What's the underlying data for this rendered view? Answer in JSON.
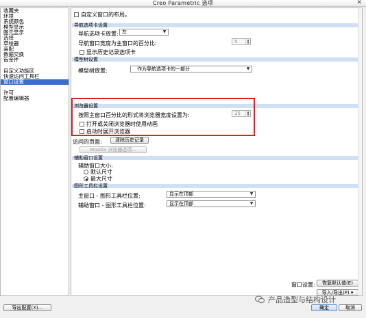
{
  "window": {
    "title": "Creo Parametric 选项",
    "close_glyph": "✕"
  },
  "sidebar": {
    "items": [
      "收藏夹",
      "环境",
      "系统颜色",
      "模型显示",
      "图元显示",
      "选择",
      "草绘器",
      "装配",
      "数据交换",
      "钣金件"
    ],
    "items2": [
      "自定义功能区",
      "快速访问工具栏",
      "窗口设置"
    ],
    "items3": [
      "许可",
      "配置编辑器"
    ],
    "selected": "窗口设置"
  },
  "top_option": {
    "label": "自定义窗口的布局。"
  },
  "nav": {
    "header": "导航选项卡设置",
    "tab_placement_label": "导航选项卡放置:",
    "tab_placement_value": "左",
    "percent_label": "导航窗口宽度为主窗口的百分比:",
    "percent_value": "5",
    "history_label": "显示历史记录选项卡"
  },
  "tree": {
    "header": "模型树设置",
    "placement_label": "模型树放置:",
    "placement_value": "作为导航选项卡的一部分"
  },
  "browser": {
    "header": "浏览器设置",
    "width_label": "按照主窗口百分比的形式将浏览器宽度设置为:",
    "width_value": "25",
    "anim_label": "打开或关闭浏览器时使用动画",
    "expand_label": "启动时展开浏览器",
    "visited_label": "访问的页面:",
    "clear_button": "清除历史记录",
    "mozilla_button": "Mozilla 浏览器选项..."
  },
  "aux": {
    "header": "辅助窗口设置",
    "size_label": "辅助窗口大小:",
    "default_size": "默认尺寸",
    "max_size": "最大尺寸"
  },
  "graphics": {
    "header": "图形工具栏设置",
    "main_label": "主窗口 - 图形工具栏位置:",
    "main_value": "显示在顶部",
    "aux_label": "辅助窗口 - 图形工具栏位置:",
    "aux_value": "显示在顶部"
  },
  "footer": {
    "window_settings_label": "窗口设置:",
    "restore_button": "恢复默认值(E)",
    "import_export_button": "导入/导出(P)",
    "export_config_button": "导出配置(X)...",
    "ok_button": "确定",
    "cancel_button": "取消"
  },
  "watermark": {
    "text": "产品造型与结构设计"
  },
  "colors": {
    "highlight_box": "#e02020",
    "section_band": "#cfe0f4",
    "selection": "#3b6fc6"
  }
}
